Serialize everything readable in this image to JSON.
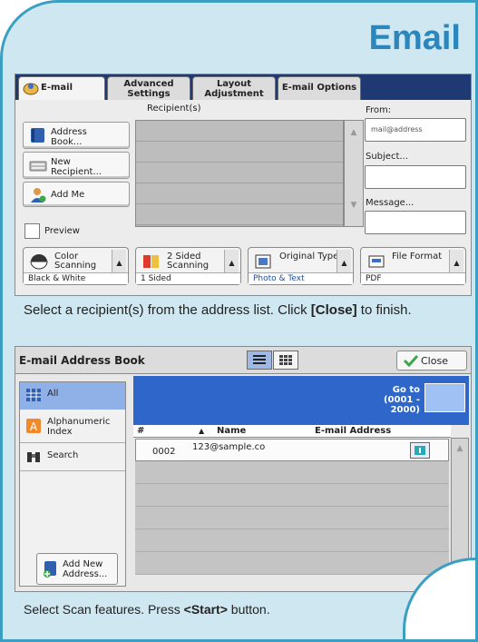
{
  "page": {
    "title": "Email"
  },
  "screen1": {
    "tabs": [
      "E-mail",
      "Advanced Settings",
      "Layout Adjustment",
      "E-mail Options"
    ],
    "recipients_label": "Recipient(s)",
    "buttons": {
      "address_book": "Address Book...",
      "new_recipient": "New Recipient...",
      "add_me": "Add Me"
    },
    "preview": "Preview",
    "from_label": "From:",
    "from_value": "mail@address",
    "subject_label": "Subject...",
    "message_label": "Message...",
    "features": [
      {
        "title": "Color Scanning",
        "value": "Black & White"
      },
      {
        "title": "2 Sided Scanning",
        "value": "1 Sided"
      },
      {
        "title": "Original Type",
        "value": "Photo & Text"
      },
      {
        "title": "File Format",
        "value": "PDF"
      }
    ],
    "scroll_up": "▲",
    "scroll_down": "▼"
  },
  "instruction1": {
    "pre": "Select a recipient(s) from the address list. Click ",
    "bold": "[Close]",
    "post": " to finish."
  },
  "screen2": {
    "title": "E-mail Address Book",
    "close": "Close",
    "sidebar": [
      "All",
      "Alphanumeric Index",
      "Search"
    ],
    "add_new": "Add New Address...",
    "goto_label": "Go to",
    "goto_range": "(0001 - 2000)",
    "columns": [
      "#",
      "Name",
      "E-mail Address"
    ],
    "entry": {
      "num": "0002",
      "name": "123@sample.co"
    }
  },
  "instruction2": {
    "pre": "Select Scan features.  Press ",
    "bold": "<Start>",
    "post": " button."
  },
  "colors": {
    "accent": "#2a86bd",
    "tab_bar": "#1f3a73",
    "list_header": "#2e67c9"
  }
}
